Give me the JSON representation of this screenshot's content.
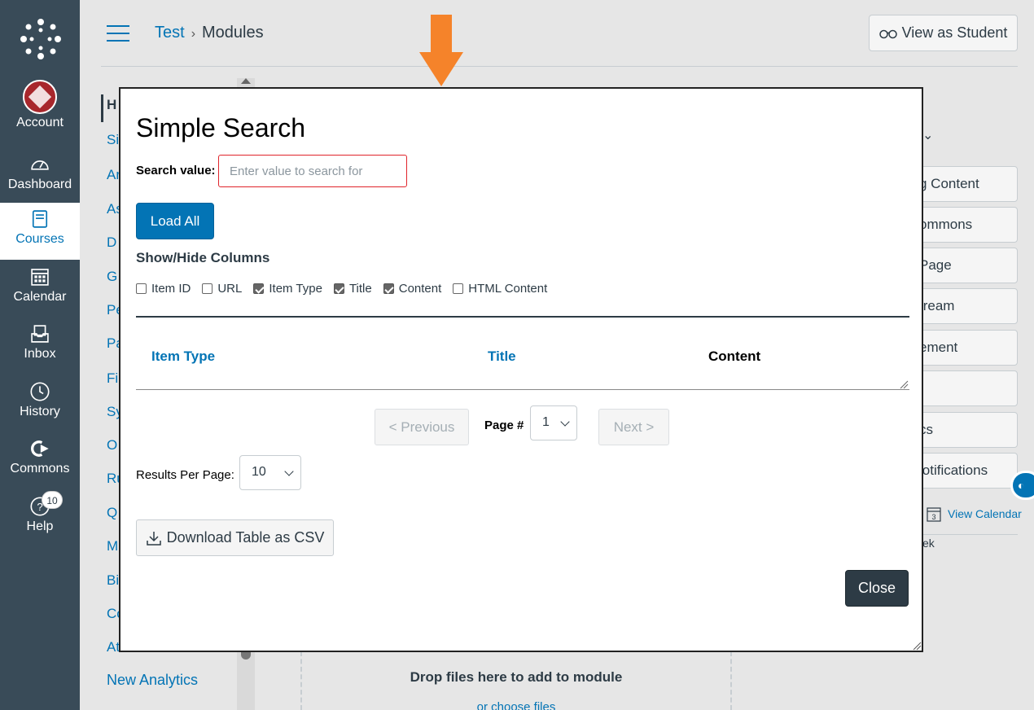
{
  "global_nav": {
    "items": [
      {
        "label": "Account",
        "icon": "account-avatar"
      },
      {
        "label": "Dashboard",
        "icon": "dashboard-icon"
      },
      {
        "label": "Courses",
        "icon": "courses-icon",
        "active": true
      },
      {
        "label": "Calendar",
        "icon": "calendar-icon"
      },
      {
        "label": "Inbox",
        "icon": "inbox-icon"
      },
      {
        "label": "History",
        "icon": "history-icon"
      },
      {
        "label": "Commons",
        "icon": "commons-icon"
      },
      {
        "label": "Help",
        "icon": "help-icon",
        "badge": "10"
      }
    ]
  },
  "header": {
    "breadcrumb_course": "Test",
    "breadcrumb_sep": "›",
    "breadcrumb_current": "Modules",
    "view_as_student": "View as Student"
  },
  "course_nav": {
    "fragments": [
      "H",
      "Si",
      "Ar",
      "As",
      "D",
      "G",
      "Pe",
      "Pa",
      "Fi",
      "Sy",
      "O",
      "Ru",
      "Q",
      "M",
      "Bi",
      "Co",
      "At"
    ],
    "last_item": "New Analytics"
  },
  "right_sidebar": {
    "buttons": [
      "g Content",
      "ommons",
      "Page",
      "tream",
      "ement",
      "",
      "cs",
      "lotifications"
    ],
    "view_calendar": "View Calendar",
    "calendar_day": "3",
    "week_fragment": "ek"
  },
  "dropzone": {
    "title": "Drop files here to add to module",
    "link": "or choose files"
  },
  "modal": {
    "title": "Simple Search",
    "search_label": "Search value:",
    "search_placeholder": "Enter value to search for",
    "load_all": "Load All",
    "show_hide_label": "Show/Hide Columns",
    "columns": [
      {
        "label": "Item ID",
        "checked": false
      },
      {
        "label": "URL",
        "checked": false
      },
      {
        "label": "Item Type",
        "checked": true
      },
      {
        "label": "Title",
        "checked": true
      },
      {
        "label": "Content",
        "checked": true
      },
      {
        "label": "HTML Content",
        "checked": false
      }
    ],
    "table_headers": {
      "item_type": "Item Type",
      "title": "Title",
      "content": "Content"
    },
    "pagination": {
      "previous": "< Previous",
      "page_label": "Page #",
      "page_value": "1",
      "next": "Next >"
    },
    "results_per_page_label": "Results Per Page:",
    "results_per_page_value": "10",
    "download_csv": "Download Table as CSV",
    "close": "Close"
  },
  "colors": {
    "accent": "#0374b5",
    "nav_bg": "#394b58",
    "arrow": "#f5832a",
    "error_border": "#e0242b"
  }
}
